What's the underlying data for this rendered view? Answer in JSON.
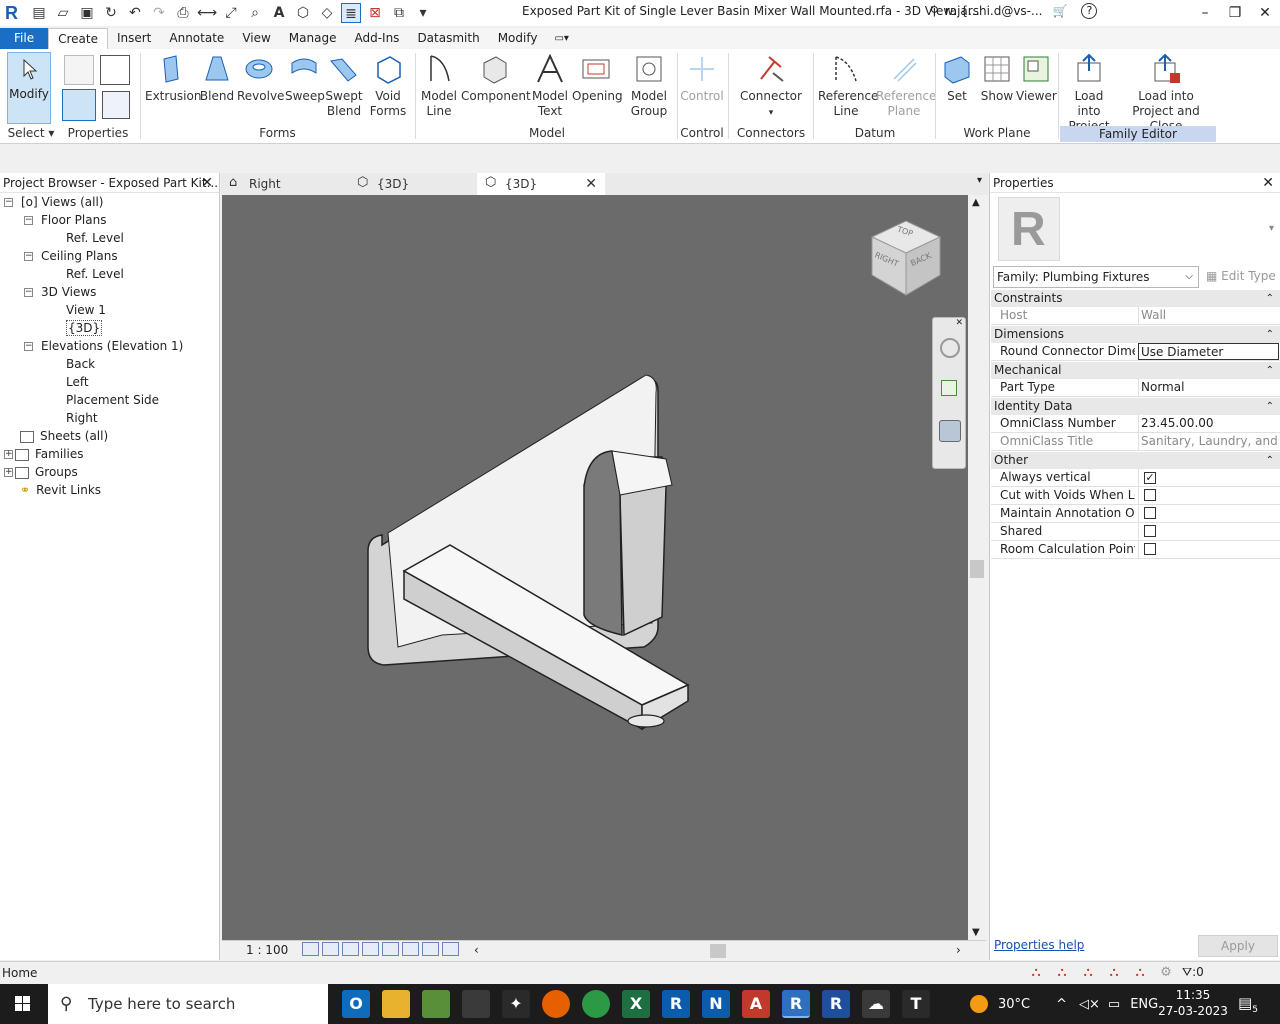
{
  "titlebar": {
    "title": "Exposed Part Kit of Single Lever Basin Mixer Wall Mounted.rfa - 3D View: {...",
    "user": "rajarshi.d@vs-...",
    "help_icon": "help-icon"
  },
  "ribbon_tabs": [
    "File",
    "Create",
    "Insert",
    "Annotate",
    "View",
    "Manage",
    "Add-Ins",
    "Datasmith",
    "Modify"
  ],
  "ribbon": {
    "modify": "Modify",
    "select": "Select",
    "properties": "Properties",
    "forms_buttons": [
      "Extrusion",
      "Blend",
      "Revolve",
      "Sweep",
      "Swept Blend",
      "Void Forms"
    ],
    "forms_label": "Forms",
    "model_buttons": [
      "Model Line",
      "Component",
      "Model Text",
      "Opening",
      "Model Group"
    ],
    "model_label": "Model",
    "control_button": "Control",
    "control_label": "Control",
    "connector_button": "Connector",
    "connectors_label": "Connectors",
    "datum_buttons": [
      "Reference Line",
      "Reference Plane"
    ],
    "datum_label": "Datum",
    "workplane_buttons": [
      "Set",
      "Show",
      "Viewer"
    ],
    "workplane_label": "Work Plane",
    "family_buttons": [
      "Load into Project",
      "Load into Project and Close"
    ],
    "family_label": "Family Editor"
  },
  "project_browser": {
    "title": "Project Browser - Exposed Part Kit...",
    "items": [
      {
        "label": "Views (all)"
      },
      {
        "label": "Floor Plans"
      },
      {
        "label": "Ref. Level"
      },
      {
        "label": "Ceiling Plans"
      },
      {
        "label": "Ref. Level"
      },
      {
        "label": "3D Views"
      },
      {
        "label": "View 1"
      },
      {
        "label": "{3D}"
      },
      {
        "label": "Elevations (Elevation 1)"
      },
      {
        "label": "Back"
      },
      {
        "label": "Left"
      },
      {
        "label": "Placement Side"
      },
      {
        "label": "Right"
      },
      {
        "label": "Sheets (all)"
      },
      {
        "label": "Families"
      },
      {
        "label": "Groups"
      },
      {
        "label": "Revit Links"
      }
    ]
  },
  "view_tabs": [
    {
      "label": "Right"
    },
    {
      "label": "{3D}"
    },
    {
      "label": "{3D}"
    }
  ],
  "viewcube": {
    "top": "TOP",
    "right": "RIGHT",
    "back": "BACK"
  },
  "viewbar": {
    "scale": "1 : 100"
  },
  "properties": {
    "title": "Properties",
    "family": "Family: Plumbing Fixtures",
    "edit_type": "Edit Type",
    "groups": {
      "constraints": "Constraints",
      "dimensions": "Dimensions",
      "mechanical": "Mechanical",
      "identity": "Identity Data",
      "other": "Other"
    },
    "rows": {
      "host_k": "Host",
      "host_v": "Wall",
      "rcd_k": "Round Connector Dime...",
      "rcd_v": "Use Diameter",
      "pt_k": "Part Type",
      "pt_v": "Normal",
      "ocn_k": "OmniClass Number",
      "ocn_v": "23.45.00.00",
      "oct_k": "OmniClass Title",
      "oct_v": "Sanitary, Laundry, and C...",
      "av_k": "Always vertical",
      "cwv_k": "Cut with Voids When Lo...",
      "mao_k": "Maintain Annotation Or...",
      "sh_k": "Shared",
      "rcp_k": "Room Calculation Point"
    },
    "checks": {
      "always_vertical": true,
      "cut_with_voids": false,
      "maintain_annotation": false,
      "shared": false,
      "room_calc": false
    },
    "help": "Properties help",
    "apply": "Apply"
  },
  "statusbar": {
    "text": "Home",
    "filter_count": ":0"
  },
  "taskbar": {
    "search_placeholder": "Type here to search",
    "temperature": "30°C",
    "language": "ENG",
    "time": "11:35",
    "date": "27-03-2023",
    "notifications": "5"
  }
}
